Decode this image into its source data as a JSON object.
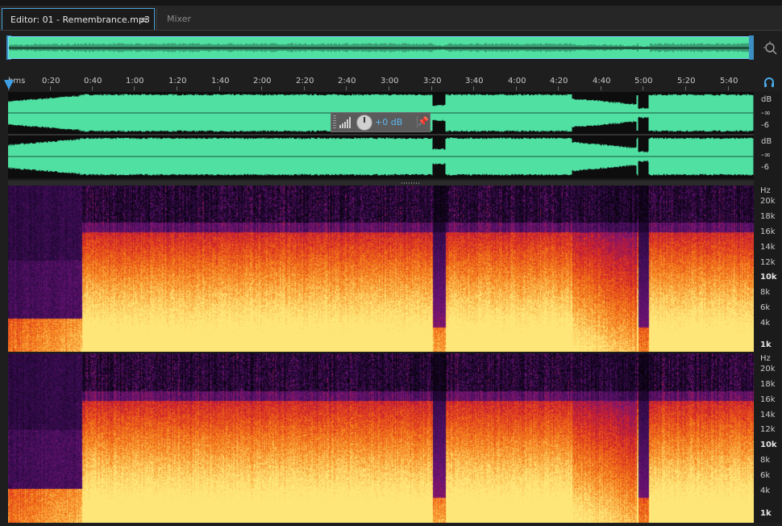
{
  "tabs": {
    "editor_label": "Editor: 01 - Remembrance.mp3",
    "menu_icon": "≡",
    "mixer_label": "Mixer"
  },
  "ruler": {
    "labels": [
      "hms",
      "0:20",
      "0:40",
      "1:00",
      "1:20",
      "1:40",
      "2:00",
      "2:20",
      "2:40",
      "3:00",
      "3:20",
      "3:40",
      "4:00",
      "4:20",
      "4:40",
      "5:00",
      "5:20",
      "5:40"
    ]
  },
  "waveform": {
    "color": "#4fe0a2",
    "channel_top": {
      "db_label": "dB",
      "inf_label": "-∞",
      "minus6_label": "-6"
    },
    "channel_bottom": {
      "db_label": "dB",
      "inf_label": "-∞",
      "minus6_label": "-6"
    }
  },
  "hud": {
    "volume_text": "+0 dB",
    "pin_icon": "📌"
  },
  "spectral": {
    "top": {
      "unit": "Hz",
      "labels": [
        "20k",
        "18k",
        "16k",
        "14k",
        "12k",
        "10k",
        "8k",
        "6k",
        "4k",
        "1k"
      ]
    },
    "bottom": {
      "unit": "Hz",
      "labels": [
        "20k",
        "18k",
        "16k",
        "14k",
        "12k",
        "10k",
        "8k",
        "6k",
        "4k",
        "1k"
      ]
    }
  },
  "icons": {
    "zoom": "zoom-icon",
    "headphone": "headphone-icon",
    "playhead": "playhead-marker-icon"
  }
}
